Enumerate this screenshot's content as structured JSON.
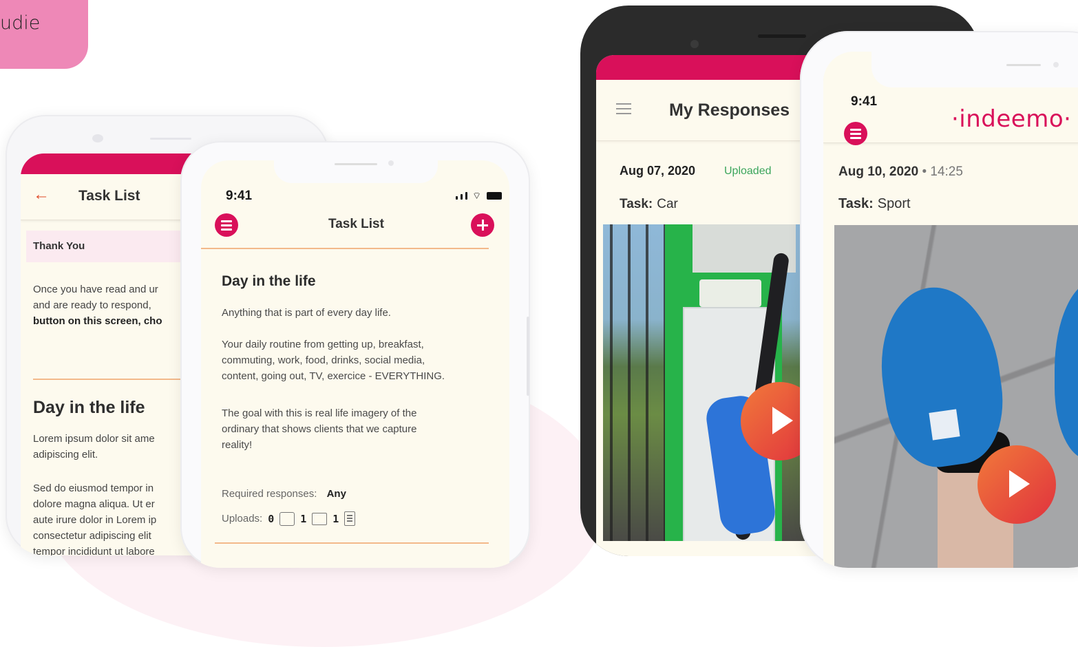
{
  "corner_tag": {
    "text": "udie"
  },
  "phone_task_list_back": {
    "header": {
      "back_icon": "←",
      "title": "Task List"
    },
    "thank_you_title": "Thank You",
    "thank_you_text": [
      "Once you have read and ur",
      "and are ready to respond, ",
      "button on this screen, cho"
    ],
    "section_title": "Day in the life",
    "lorem_1": [
      "Lorem ipsum dolor sit ame",
      "adipiscing elit."
    ],
    "lorem_2": [
      "Sed do eiusmod tempor in",
      "dolore magna aliqua. Ut er",
      "aute irure dolor in Lorem ip",
      "consectetur adipiscing elit",
      "tempor incididunt ut labore"
    ]
  },
  "phone_task_list_front": {
    "status": {
      "time": "9:41"
    },
    "header": {
      "menu_icon": "menu-icon",
      "title": "Task List",
      "add_icon": "plus-icon"
    },
    "task_title": "Day in the life",
    "paragraphs": [
      "Anything that is part of every day life.",
      "Your daily routine from getting up, breakfast,\ncommuting, work, food, drinks, social media,\ncontent, going out, TV, exercice - EVERYTHING.",
      "The goal with this is real life imagery of the\nordinary that shows clients that we capture\nreality!"
    ],
    "required_label": "Required responses:",
    "required_value": "Any",
    "uploads_label": "Uploads:",
    "uploads": [
      {
        "count": "0",
        "icon": "image-icon"
      },
      {
        "count": "1",
        "icon": "video-icon"
      },
      {
        "count": "1",
        "icon": "document-icon"
      }
    ]
  },
  "phone_my_responses": {
    "header": {
      "title": "My Responses",
      "menu_icon": "hamburger-icon"
    },
    "date": "Aug 07, 2020",
    "status": "Uploaded",
    "task_label": "Task:",
    "task_value": "Car",
    "status_color": "#3ba55c"
  },
  "phone_response_detail": {
    "status": {
      "time": "9:41"
    },
    "logo_text": "·indeemo·",
    "date": "Aug 10, 2020",
    "time_sep": " • ",
    "time": "14:25",
    "task_label": "Task:",
    "task_value": "Sport"
  },
  "colors": {
    "brand_pink": "#d9105a",
    "accent_orange": "#f3b98a",
    "tag_pink": "#ee88b7"
  }
}
